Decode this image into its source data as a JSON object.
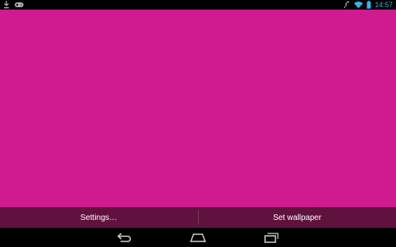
{
  "status_bar": {
    "time": "14:57",
    "left_icons": [
      "download-icon",
      "gamepad-icon"
    ],
    "right_icons": [
      "signal-wave-icon",
      "wifi-icon",
      "battery-icon"
    ],
    "accent_color": "#33b5e5"
  },
  "wallpaper": {
    "color": "#cf1a90"
  },
  "actions": {
    "settings_label": "Settings…",
    "set_wallpaper_label": "Set wallpaper",
    "bar_color": "#60123f"
  },
  "nav": {
    "icons": [
      "back-icon",
      "home-icon",
      "recents-icon"
    ]
  }
}
